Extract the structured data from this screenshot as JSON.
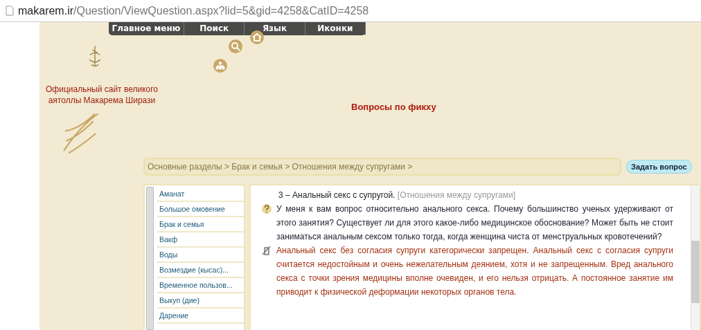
{
  "address_bar": {
    "domain": "makarem.ir",
    "path": "/Question/ViewQuestion.aspx?lid=5&gid=4258&CatID=4258"
  },
  "nav_menu": [
    "Главное меню",
    "Поиск",
    "Язык",
    "Иконки"
  ],
  "site_title": "Официальный сайт великого аятоллы Макарема Ширази",
  "page_heading": "Вопросы по фикху",
  "breadcrumb": "Основные разделы > Брак и семья > Отношения между супругами >",
  "ask_button": "Задать вопрос",
  "sidebar": {
    "items": [
      "Аманат",
      "Большое омовение",
      "Брак и семья",
      "Вакф",
      "Воды",
      "Возмездие (кысас)...",
      "Временное пользов...",
      "Выкуп (дие)",
      "Дарение"
    ]
  },
  "question": {
    "title": "3 – Анальный секс с супругой.",
    "category": "[Отношения между супругами]",
    "text": "У меня к вам вопрос относительно анального секса. Почему большинство ученых удерживают от этого занятия? Существует ли для этого какое-либо медицинское обоснование? Может быть не стоит заниматься анальным сексом только тогда, когда женщина чиста от менструальных кровотечений?",
    "answer": "Анальный секс без согласия супруги категорически запрещен. Анальный секс с согласия супруги считается недостойным и очень нежелательным деянием, хотя и не запрещенным. Вред анального секса с точки зрения медицины вполне очевиден, и его нельзя отрицать. А постоянное занятие им приводит к физической деформации некоторых органов тела."
  }
}
